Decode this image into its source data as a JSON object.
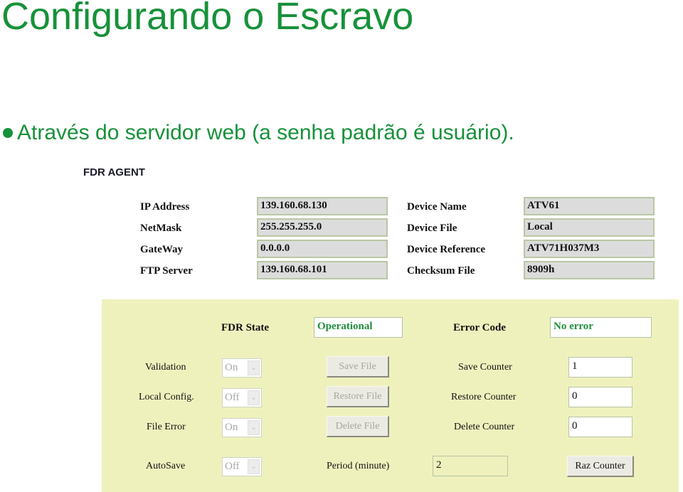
{
  "slide": {
    "title": "Configurando o Escravo",
    "bullet": "Através do servidor web (a senha padrão é usuário).",
    "accent_color": "#17913a"
  },
  "agent": {
    "title": "FDR AGENT",
    "network": [
      {
        "label": "IP Address",
        "value": "139.160.68.130"
      },
      {
        "label": "NetMask",
        "value": "255.255.255.0"
      },
      {
        "label": "GateWay",
        "value": "0.0.0.0"
      },
      {
        "label": "FTP Server",
        "value": "139.160.68.101"
      }
    ],
    "device": [
      {
        "label": "Device Name",
        "value": "ATV61"
      },
      {
        "label": "Device File",
        "value": "Local"
      },
      {
        "label": "Device Reference",
        "value": "ATV71H037M3"
      },
      {
        "label": "Checksum File",
        "value": "8909h"
      }
    ]
  },
  "panel": {
    "fdr_state_label": "FDR State",
    "fdr_state_value": "Operational",
    "error_code_label": "Error Code",
    "error_code_value": "No error",
    "validation": {
      "label": "Validation",
      "value": "On"
    },
    "local_config": {
      "label": "Local Config.",
      "value": "Off"
    },
    "file_error": {
      "label": "File Error",
      "value": "On"
    },
    "autosave": {
      "label": "AutoSave",
      "value": "Off"
    },
    "save_file_button": "Save File",
    "restore_file_button": "Restore File",
    "delete_file_button": "Delete File",
    "period_label": "Period (minute)",
    "period_value": "2",
    "save_counter": {
      "label": "Save Counter",
      "value": "1"
    },
    "restore_counter": {
      "label": "Restore Counter",
      "value": "0"
    },
    "delete_counter": {
      "label": "Delete Counter",
      "value": "0"
    },
    "raz_counter_button": "Raz Counter",
    "status_text_color": "#1f8f3c",
    "background_color": "#eff1bd"
  }
}
